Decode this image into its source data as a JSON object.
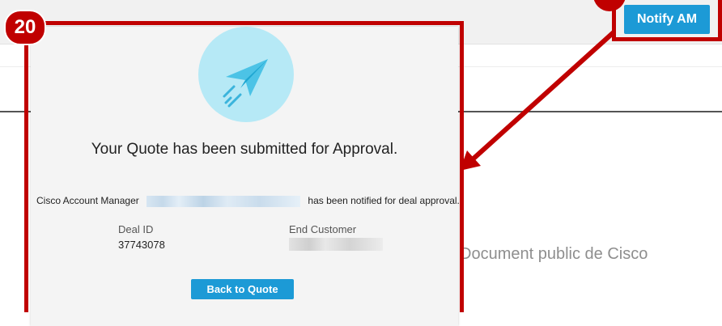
{
  "header": {
    "notify_label": "Notify AM"
  },
  "background": {
    "document_text": "Document public de Cisco"
  },
  "annotation": {
    "step_number": "20",
    "color": "#c00000"
  },
  "modal": {
    "title": "Your Quote has been submitted for Approval.",
    "am_prefix": "Cisco Account Manager",
    "am_suffix": "has been notified for deal approval.",
    "deal_id_label": "Deal ID",
    "deal_id_value": "37743078",
    "end_customer_label": "End Customer",
    "back_button_label": "Back to Quote",
    "icon": "paper-plane-icon"
  },
  "colors": {
    "accent": "#1c9ad6",
    "plane_circle": "#b6e9f6"
  }
}
